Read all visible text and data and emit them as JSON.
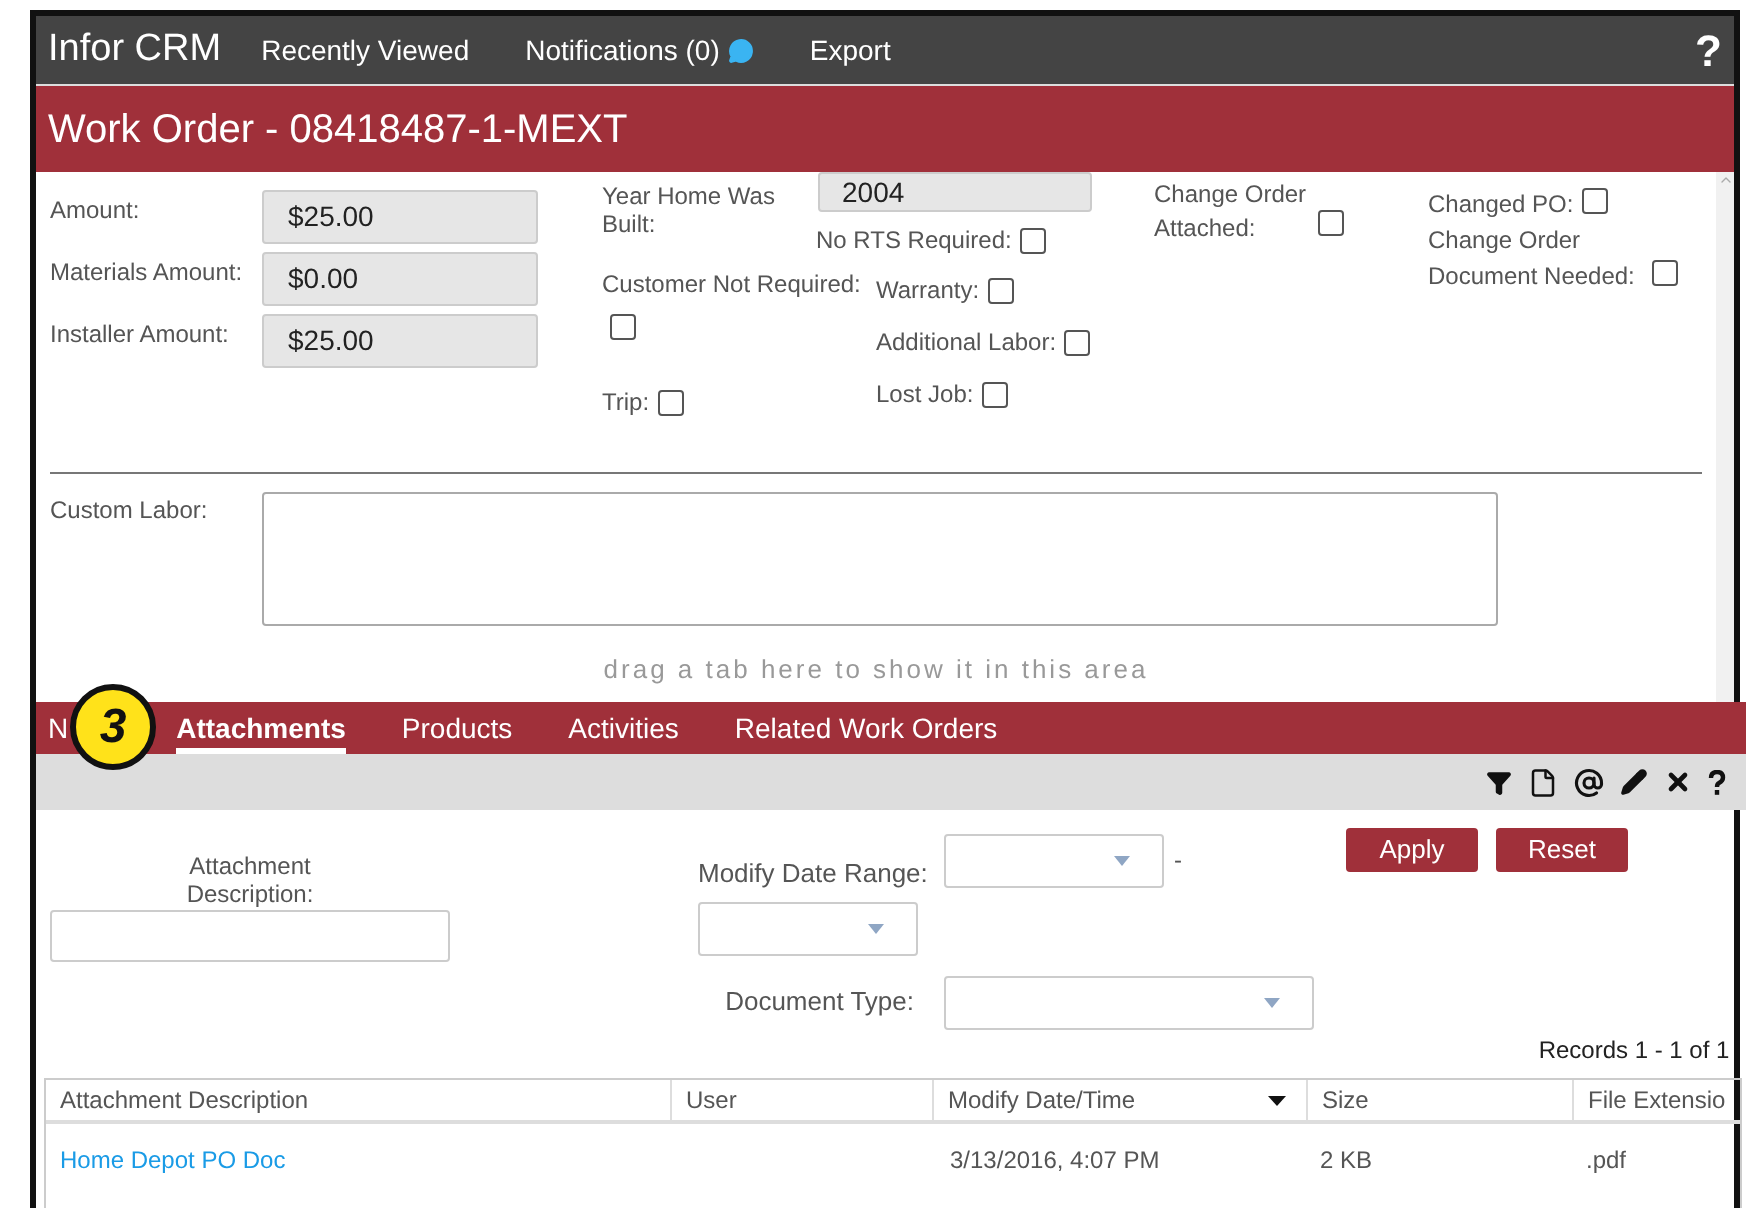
{
  "topbar": {
    "brand": "Infor CRM",
    "menu": [
      {
        "label": "Recently Viewed",
        "icon": false
      },
      {
        "label": "Notifications (0)",
        "icon": true
      },
      {
        "label": "Export",
        "icon": false
      }
    ],
    "help": "?"
  },
  "title": "Work Order - 08418487-1-MEXT",
  "form": {
    "column_1": [
      {
        "label": "Amount:",
        "value": "$25.00"
      },
      {
        "label": "Materials Amount:",
        "value": "$0.00"
      },
      {
        "label": "Installer Amount:",
        "value": "$25.00"
      }
    ],
    "year_built": {
      "label": "Year Home Was Built:",
      "value": "2004"
    },
    "column_2_checks": [
      {
        "label": "No RTS Required:",
        "checked": false
      },
      {
        "label": "Customer Not Required:",
        "checked": false
      },
      {
        "label": "Trip:",
        "checked": false
      },
      {
        "label": "Warranty:",
        "checked": false
      },
      {
        "label": "Additional Labor:",
        "checked": false
      },
      {
        "label": "Lost Job:",
        "checked": false
      }
    ],
    "column_3_checks": [
      {
        "label": "Change Order Attached:",
        "checked": false
      }
    ],
    "column_4_checks": [
      {
        "label": "Changed PO:",
        "checked": false
      },
      {
        "label": "Change Order Document Needed:",
        "checked": false
      }
    ],
    "custom_labor": {
      "label": "Custom Labor:"
    }
  },
  "drag_hint": "drag a tab here to show it in this area",
  "tabs": [
    {
      "label": "N",
      "selected": false
    },
    {
      "label": "Attachments",
      "selected": true
    },
    {
      "label": "Products",
      "selected": false
    },
    {
      "label": "Activities",
      "selected": false
    },
    {
      "label": "Related Work Orders",
      "selected": false
    }
  ],
  "callout": "3",
  "filters": {
    "description_label": "Attachment Description:",
    "date_range_label": "Modify Date Range:",
    "range_separator": "-",
    "document_type_label": "Document Type:",
    "buttons": [
      "Apply",
      "Reset"
    ]
  },
  "records": "Records 1 - 1 of 1",
  "table": {
    "columns": [
      {
        "label": "Attachment Description",
        "sorted": false
      },
      {
        "label": "User",
        "sorted": false
      },
      {
        "label": "Modify Date/Time",
        "sorted": true
      },
      {
        "label": "Size",
        "sorted": false
      },
      {
        "label": "File Extensio",
        "sorted": false
      }
    ],
    "rows": [
      [
        "Home Depot PO Doc",
        "",
        "3/13/2016, 4:07 PM",
        "2 KB",
        ".pdf"
      ]
    ]
  }
}
